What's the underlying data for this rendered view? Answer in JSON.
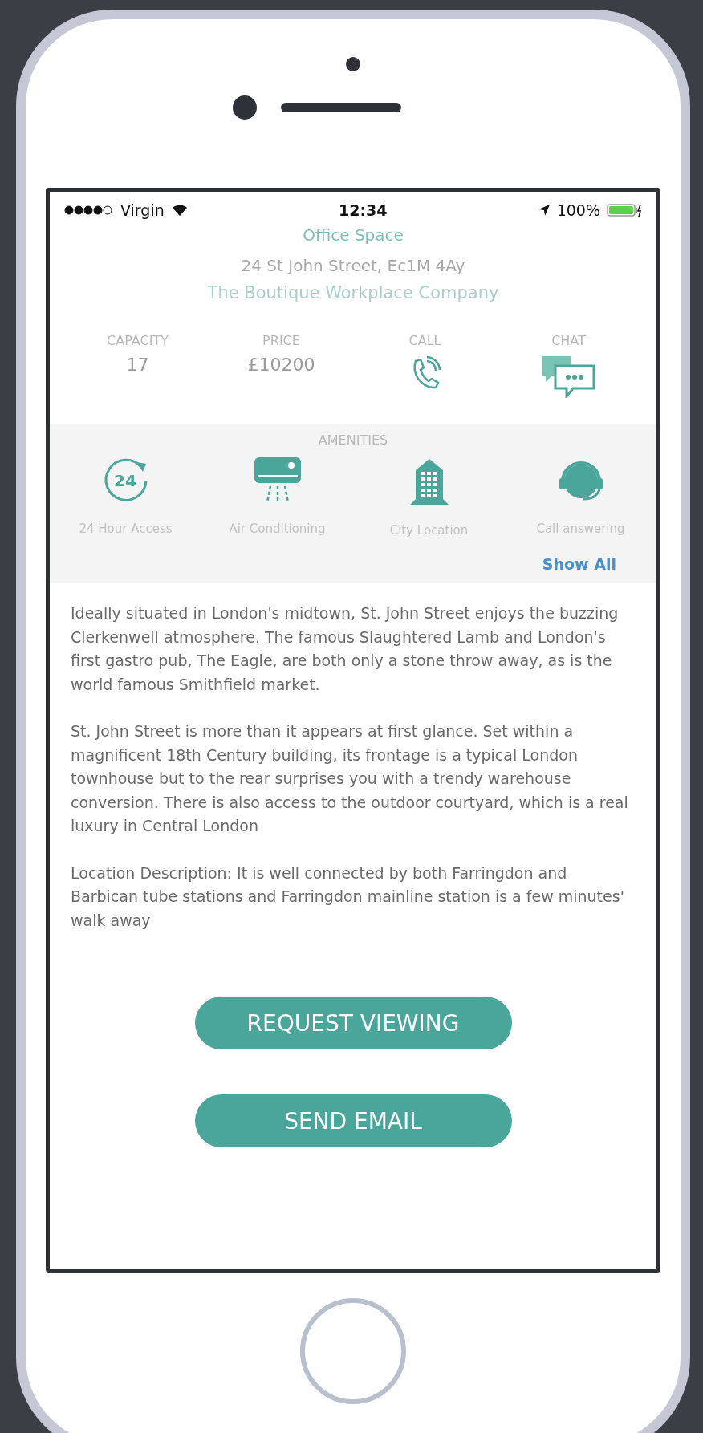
{
  "status_bar": {
    "carrier": "Virgin",
    "time": "12:34",
    "battery": "100%"
  },
  "title": "Office Space",
  "address": "24 St John Street, Ec1M 4Ay",
  "company": "The Boutique Workplace Company",
  "stats": [
    {
      "kind": "value",
      "label": "CAPACITY",
      "value": "17"
    },
    {
      "kind": "value",
      "label": "PRICE",
      "value": "£10200"
    },
    {
      "kind": "call",
      "label": "CALL"
    },
    {
      "kind": "chat",
      "label": "CHAT"
    }
  ],
  "amenities": {
    "heading": "AMENITIES",
    "items": [
      {
        "kind": "clock",
        "icon_text": "24",
        "label": "24 Hour Access"
      },
      {
        "kind": "aircon",
        "label": "Air Conditioning"
      },
      {
        "kind": "building",
        "label": "City Location"
      },
      {
        "kind": "headset",
        "label": "Call answering"
      }
    ],
    "show_all": "Show All"
  },
  "description": [
    "Ideally situated in London's midtown, St. John Street enjoys the buzzing Clerkenwell atmosphere. The famous Slaughtered Lamb and London's first gastro pub, The Eagle, are both only a stone throw away, as is the world famous Smithfield market.",
    "St. John Street is more than it appears at first glance. Set within a magnificent 18th Century building, its frontage is a typical London townhouse but to the rear surprises you with a trendy warehouse conversion. There is also access to the outdoor courtyard, which is a real luxury in Central London",
    "Location Description: It is well connected by both Farringdon and Barbican tube stations and Farringdon mainline station is a few minutes' walk away"
  ],
  "buttons": [
    "REQUEST VIEWING",
    "SEND EMAIL"
  ]
}
